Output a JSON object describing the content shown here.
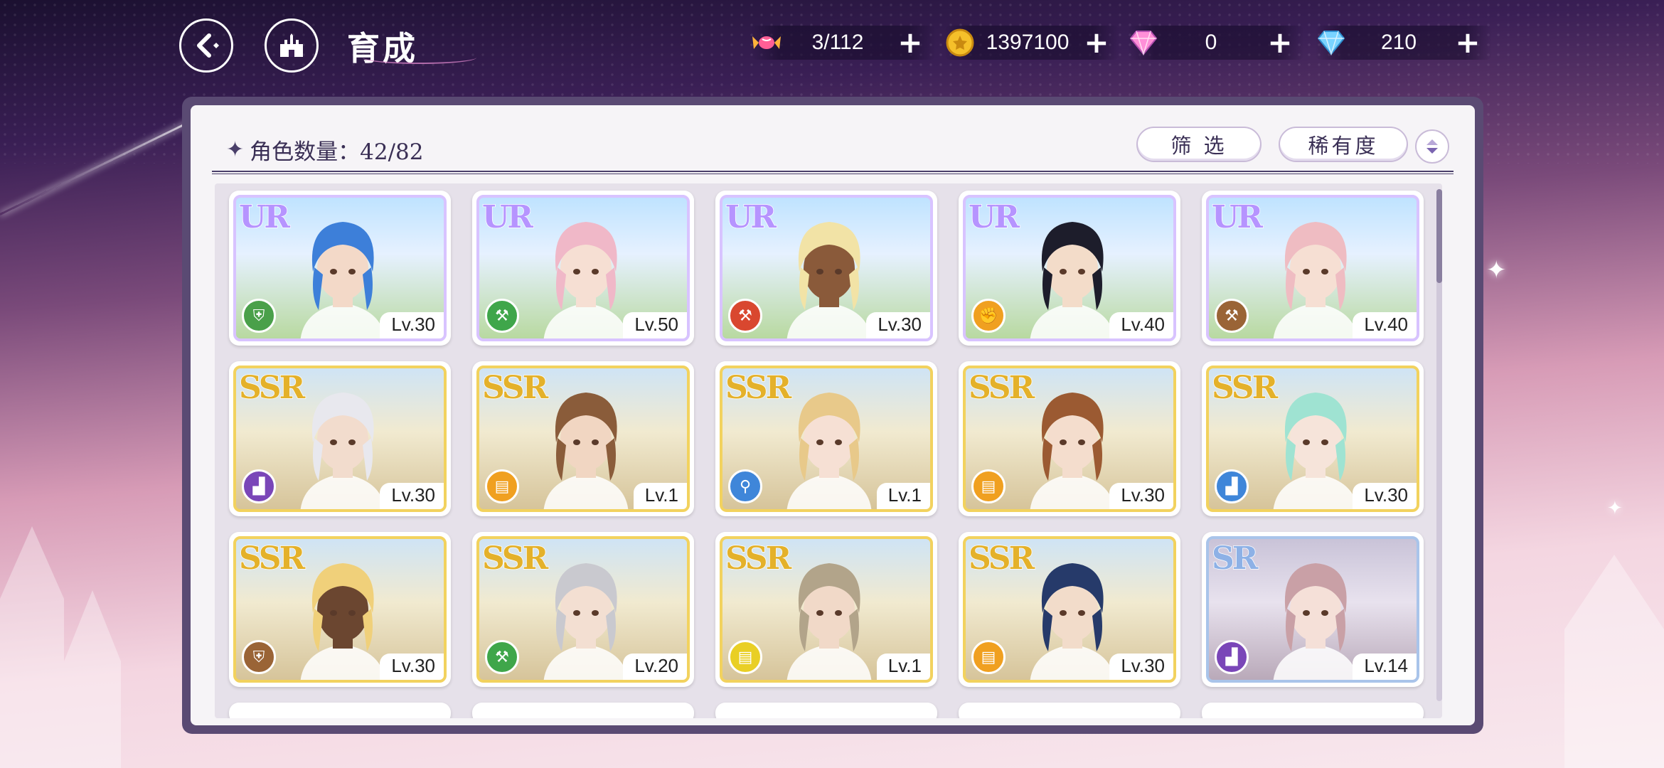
{
  "header": {
    "title": "育成"
  },
  "resources": [
    {
      "name": "candy",
      "value": "3/112",
      "color": "#ff7aa8"
    },
    {
      "name": "coin",
      "value": "1397100",
      "color": "#f5c02a"
    },
    {
      "name": "pink-diamond",
      "value": "0",
      "color": "#ff8fd8"
    },
    {
      "name": "blue-diamond",
      "value": "210",
      "color": "#7ad3ff"
    }
  ],
  "panel": {
    "count_label": "角色数量：42/82",
    "filter_label": "筛 选",
    "sort_label": "稀有度"
  },
  "cards": [
    {
      "rarity": "UR",
      "level": "Lv.30",
      "element": "shield",
      "element_color": "#4aa04a",
      "hair": "#3d7fd9",
      "skin": "#f3d9c8"
    },
    {
      "rarity": "UR",
      "level": "Lv.50",
      "element": "hammer",
      "element_color": "#3fa64a",
      "hair": "#f0b8c8",
      "skin": "#f6dfd3"
    },
    {
      "rarity": "UR",
      "level": "Lv.30",
      "element": "hammer",
      "element_color": "#d9472f",
      "hair": "#f2e3a6",
      "skin": "#8a5a3a"
    },
    {
      "rarity": "UR",
      "level": "Lv.40",
      "element": "fist",
      "element_color": "#f0a020",
      "hair": "#1d1d2b",
      "skin": "#f3dcc9"
    },
    {
      "rarity": "UR",
      "level": "Lv.40",
      "element": "hammer",
      "element_color": "#9a6436",
      "hair": "#efbcc2",
      "skin": "#f6dfd3"
    },
    {
      "rarity": "SSR",
      "level": "Lv.30",
      "element": "boot",
      "element_color": "#7a46b8",
      "hair": "#e8e8ee",
      "skin": "#f2dccd"
    },
    {
      "rarity": "SSR",
      "level": "Lv.1",
      "element": "book",
      "element_color": "#f0a020",
      "hair": "#8a5c3a",
      "skin": "#f1d6c2"
    },
    {
      "rarity": "SSR",
      "level": "Lv.1",
      "element": "wrench",
      "element_color": "#3f86d9",
      "hair": "#e8c98a",
      "skin": "#f6e0d4"
    },
    {
      "rarity": "SSR",
      "level": "Lv.30",
      "element": "book",
      "element_color": "#f0a020",
      "hair": "#9b5a32",
      "skin": "#f4ddcd"
    },
    {
      "rarity": "SSR",
      "level": "Lv.30",
      "element": "boot",
      "element_color": "#3f86d9",
      "hair": "#9fe3d2",
      "skin": "#f6e4da"
    },
    {
      "rarity": "SSR",
      "level": "Lv.30",
      "element": "shield",
      "element_color": "#9a6436",
      "hair": "#f0d07a",
      "skin": "#6b4630"
    },
    {
      "rarity": "SSR",
      "level": "Lv.20",
      "element": "hammer",
      "element_color": "#3fa64a",
      "hair": "#c9c9cf",
      "skin": "#f3dfd2"
    },
    {
      "rarity": "SSR",
      "level": "Lv.1",
      "element": "book",
      "element_color": "#e9cf25",
      "hair": "#b2a48a",
      "skin": "#f1d9c8"
    },
    {
      "rarity": "SSR",
      "level": "Lv.30",
      "element": "book",
      "element_color": "#f0a020",
      "hair": "#263a6a",
      "skin": "#f2dcca"
    },
    {
      "rarity": "SR",
      "level": "Lv.14",
      "element": "boot",
      "element_color": "#7a46b8",
      "hair": "#c9a0a6",
      "skin": "#f5e0d8"
    }
  ]
}
